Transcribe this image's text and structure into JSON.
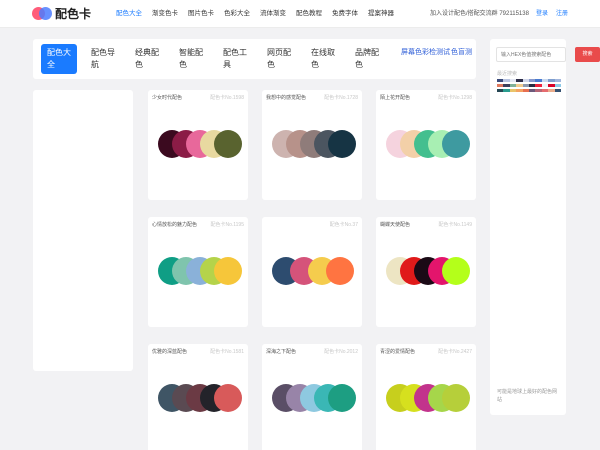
{
  "header": {
    "logo_text": "配色卡",
    "nav": [
      "配色大全",
      "渐变色卡",
      "图片色卡",
      "色彩大全",
      "流体渐变",
      "配色教程",
      "免费字体",
      "提案神器"
    ],
    "contact": "加入设计配色/搭配交流群 792115138",
    "login": "登录",
    "register": "注册"
  },
  "categories": [
    {
      "label": "配色大全",
      "active": true
    },
    {
      "label": "配色导航"
    },
    {
      "label": "经典配色"
    },
    {
      "label": "智能配色"
    },
    {
      "label": "配色工具"
    },
    {
      "label": "网页配色"
    },
    {
      "label": "在线取色"
    },
    {
      "label": "品牌配色"
    },
    {
      "label": "屏幕色彩检测试"
    },
    {
      "label": "色盲测"
    }
  ],
  "cards": [
    {
      "title": "少女时代配色",
      "no": "配色卡No.1598",
      "colors": [
        "#3b0a1f",
        "#8b1c46",
        "#e8689b",
        "#e8d9a0",
        "#59632f"
      ]
    },
    {
      "title": "我想中的感觉配色",
      "no": "配色卡No.1728",
      "colors": [
        "#cdb3af",
        "#b7928a",
        "#8f7c7a",
        "#4b5560",
        "#163444"
      ]
    },
    {
      "title": "陌上花开配色",
      "no": "配色卡No.1298",
      "colors": [
        "#f5d3de",
        "#f3d0a8",
        "#43bf8f",
        "#a8efb3",
        "#3e9aa0"
      ]
    },
    {
      "title": "心情放松的魅力配色",
      "no": "配色卡No.1195",
      "colors": [
        "#0f9e85",
        "#7fc4ad",
        "#8ab1d9",
        "#b5d34a",
        "#f6c63a"
      ]
    },
    {
      "title": "",
      "no": "配色卡No.37",
      "colors": [
        "#2d4c6f",
        "#d5537a",
        "#f5cc4d",
        "#ff7441"
      ]
    },
    {
      "title": "蝴蝶天使配色",
      "no": "配色卡No.1149",
      "colors": [
        "#ede5c3",
        "#e01a1a",
        "#1b0a16",
        "#e3156c",
        "#b4ff1a"
      ]
    },
    {
      "title": "优雅的深蓝配色",
      "no": "配色卡No.1581",
      "colors": [
        "#3f5565",
        "#5a4a52",
        "#6b3a44",
        "#23232a",
        "#d85a5a"
      ]
    },
    {
      "title": "深海之下配色",
      "no": "配色卡No.2012",
      "colors": [
        "#5a4e66",
        "#9884a8",
        "#8ec9e0",
        "#3ab7b5",
        "#1d9e82"
      ]
    },
    {
      "title": "青涩的爱情配色",
      "no": "配色卡No.2427",
      "colors": [
        "#c7cf1d",
        "#d6e01e",
        "#c2338c",
        "#a6d64a",
        "#b6cf3a"
      ]
    }
  ],
  "right": {
    "hex_placeholder": "输入HEX色值搜索配色",
    "search_label": "搜索",
    "history_label": "最近搜索",
    "strips": [
      [
        "#3a4a7a",
        "#b7c3e0",
        "#e4e8f4",
        "#2d2d48",
        "#d0d6ea",
        "#8899cc",
        "#4a7bd0",
        "#c9d9ef",
        "#7f9fcf",
        "#a2b6dd"
      ],
      [
        "#e07a5f",
        "#3d405b",
        "#81b29a",
        "#f2cc8f",
        "#8d99ae",
        "#2b2d42",
        "#ef233c",
        "#edf2f4",
        "#d90429",
        "#8ecae6"
      ],
      [
        "#264653",
        "#2a9d8f",
        "#e9c46a",
        "#f4a261",
        "#e76f51",
        "#6d597a",
        "#b56576",
        "#e56b6f",
        "#eaac8b",
        "#355070"
      ]
    ],
    "tip": "可能是地球上最好的配色网站"
  }
}
